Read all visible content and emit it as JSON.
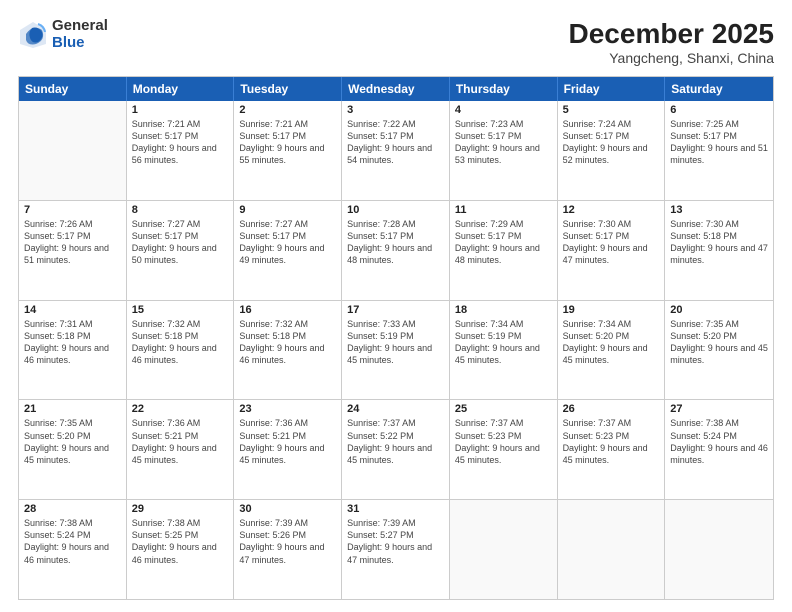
{
  "logo": {
    "general": "General",
    "blue": "Blue"
  },
  "title": {
    "month_year": "December 2025",
    "location": "Yangcheng, Shanxi, China"
  },
  "days_of_week": [
    "Sunday",
    "Monday",
    "Tuesday",
    "Wednesday",
    "Thursday",
    "Friday",
    "Saturday"
  ],
  "weeks": [
    [
      {
        "day": "",
        "sunrise": "",
        "sunset": "",
        "daylight": ""
      },
      {
        "day": "1",
        "sunrise": "Sunrise: 7:21 AM",
        "sunset": "Sunset: 5:17 PM",
        "daylight": "Daylight: 9 hours and 56 minutes."
      },
      {
        "day": "2",
        "sunrise": "Sunrise: 7:21 AM",
        "sunset": "Sunset: 5:17 PM",
        "daylight": "Daylight: 9 hours and 55 minutes."
      },
      {
        "day": "3",
        "sunrise": "Sunrise: 7:22 AM",
        "sunset": "Sunset: 5:17 PM",
        "daylight": "Daylight: 9 hours and 54 minutes."
      },
      {
        "day": "4",
        "sunrise": "Sunrise: 7:23 AM",
        "sunset": "Sunset: 5:17 PM",
        "daylight": "Daylight: 9 hours and 53 minutes."
      },
      {
        "day": "5",
        "sunrise": "Sunrise: 7:24 AM",
        "sunset": "Sunset: 5:17 PM",
        "daylight": "Daylight: 9 hours and 52 minutes."
      },
      {
        "day": "6",
        "sunrise": "Sunrise: 7:25 AM",
        "sunset": "Sunset: 5:17 PM",
        "daylight": "Daylight: 9 hours and 51 minutes."
      }
    ],
    [
      {
        "day": "7",
        "sunrise": "Sunrise: 7:26 AM",
        "sunset": "Sunset: 5:17 PM",
        "daylight": "Daylight: 9 hours and 51 minutes."
      },
      {
        "day": "8",
        "sunrise": "Sunrise: 7:27 AM",
        "sunset": "Sunset: 5:17 PM",
        "daylight": "Daylight: 9 hours and 50 minutes."
      },
      {
        "day": "9",
        "sunrise": "Sunrise: 7:27 AM",
        "sunset": "Sunset: 5:17 PM",
        "daylight": "Daylight: 9 hours and 49 minutes."
      },
      {
        "day": "10",
        "sunrise": "Sunrise: 7:28 AM",
        "sunset": "Sunset: 5:17 PM",
        "daylight": "Daylight: 9 hours and 48 minutes."
      },
      {
        "day": "11",
        "sunrise": "Sunrise: 7:29 AM",
        "sunset": "Sunset: 5:17 PM",
        "daylight": "Daylight: 9 hours and 48 minutes."
      },
      {
        "day": "12",
        "sunrise": "Sunrise: 7:30 AM",
        "sunset": "Sunset: 5:17 PM",
        "daylight": "Daylight: 9 hours and 47 minutes."
      },
      {
        "day": "13",
        "sunrise": "Sunrise: 7:30 AM",
        "sunset": "Sunset: 5:18 PM",
        "daylight": "Daylight: 9 hours and 47 minutes."
      }
    ],
    [
      {
        "day": "14",
        "sunrise": "Sunrise: 7:31 AM",
        "sunset": "Sunset: 5:18 PM",
        "daylight": "Daylight: 9 hours and 46 minutes."
      },
      {
        "day": "15",
        "sunrise": "Sunrise: 7:32 AM",
        "sunset": "Sunset: 5:18 PM",
        "daylight": "Daylight: 9 hours and 46 minutes."
      },
      {
        "day": "16",
        "sunrise": "Sunrise: 7:32 AM",
        "sunset": "Sunset: 5:18 PM",
        "daylight": "Daylight: 9 hours and 46 minutes."
      },
      {
        "day": "17",
        "sunrise": "Sunrise: 7:33 AM",
        "sunset": "Sunset: 5:19 PM",
        "daylight": "Daylight: 9 hours and 45 minutes."
      },
      {
        "day": "18",
        "sunrise": "Sunrise: 7:34 AM",
        "sunset": "Sunset: 5:19 PM",
        "daylight": "Daylight: 9 hours and 45 minutes."
      },
      {
        "day": "19",
        "sunrise": "Sunrise: 7:34 AM",
        "sunset": "Sunset: 5:20 PM",
        "daylight": "Daylight: 9 hours and 45 minutes."
      },
      {
        "day": "20",
        "sunrise": "Sunrise: 7:35 AM",
        "sunset": "Sunset: 5:20 PM",
        "daylight": "Daylight: 9 hours and 45 minutes."
      }
    ],
    [
      {
        "day": "21",
        "sunrise": "Sunrise: 7:35 AM",
        "sunset": "Sunset: 5:20 PM",
        "daylight": "Daylight: 9 hours and 45 minutes."
      },
      {
        "day": "22",
        "sunrise": "Sunrise: 7:36 AM",
        "sunset": "Sunset: 5:21 PM",
        "daylight": "Daylight: 9 hours and 45 minutes."
      },
      {
        "day": "23",
        "sunrise": "Sunrise: 7:36 AM",
        "sunset": "Sunset: 5:21 PM",
        "daylight": "Daylight: 9 hours and 45 minutes."
      },
      {
        "day": "24",
        "sunrise": "Sunrise: 7:37 AM",
        "sunset": "Sunset: 5:22 PM",
        "daylight": "Daylight: 9 hours and 45 minutes."
      },
      {
        "day": "25",
        "sunrise": "Sunrise: 7:37 AM",
        "sunset": "Sunset: 5:23 PM",
        "daylight": "Daylight: 9 hours and 45 minutes."
      },
      {
        "day": "26",
        "sunrise": "Sunrise: 7:37 AM",
        "sunset": "Sunset: 5:23 PM",
        "daylight": "Daylight: 9 hours and 45 minutes."
      },
      {
        "day": "27",
        "sunrise": "Sunrise: 7:38 AM",
        "sunset": "Sunset: 5:24 PM",
        "daylight": "Daylight: 9 hours and 46 minutes."
      }
    ],
    [
      {
        "day": "28",
        "sunrise": "Sunrise: 7:38 AM",
        "sunset": "Sunset: 5:24 PM",
        "daylight": "Daylight: 9 hours and 46 minutes."
      },
      {
        "day": "29",
        "sunrise": "Sunrise: 7:38 AM",
        "sunset": "Sunset: 5:25 PM",
        "daylight": "Daylight: 9 hours and 46 minutes."
      },
      {
        "day": "30",
        "sunrise": "Sunrise: 7:39 AM",
        "sunset": "Sunset: 5:26 PM",
        "daylight": "Daylight: 9 hours and 47 minutes."
      },
      {
        "day": "31",
        "sunrise": "Sunrise: 7:39 AM",
        "sunset": "Sunset: 5:27 PM",
        "daylight": "Daylight: 9 hours and 47 minutes."
      },
      {
        "day": "",
        "sunrise": "",
        "sunset": "",
        "daylight": ""
      },
      {
        "day": "",
        "sunrise": "",
        "sunset": "",
        "daylight": ""
      },
      {
        "day": "",
        "sunrise": "",
        "sunset": "",
        "daylight": ""
      }
    ]
  ]
}
